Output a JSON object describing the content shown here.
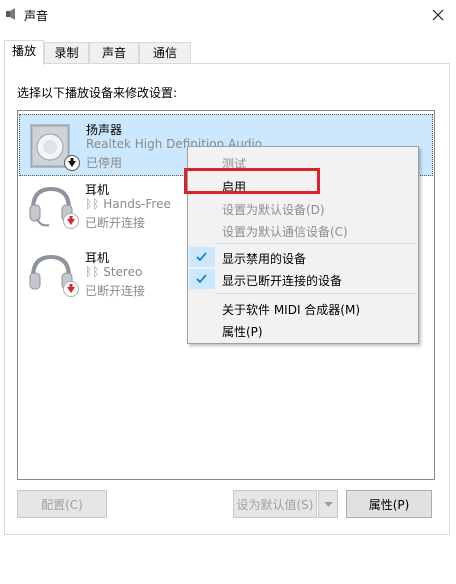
{
  "window": {
    "title": "声音"
  },
  "tabs": [
    {
      "label": "播放",
      "active": true
    },
    {
      "label": "录制",
      "active": false
    },
    {
      "label": "声音",
      "active": false
    },
    {
      "label": "通信",
      "active": false
    }
  ],
  "instruction": "选择以下播放设备来修改设置:",
  "devices": [
    {
      "name": "扬声器",
      "subtitle": "Realtek High Definition Audio",
      "status": "已停用",
      "icon": "speaker-icon",
      "badge": "disabled-arrow-icon",
      "selected": true
    },
    {
      "name": "耳机",
      "subtitle": "Hands-Free",
      "status": "已断开连接",
      "icon": "headset-icon",
      "badge": "disconnected-arrow-icon",
      "selected": false
    },
    {
      "name": "耳机",
      "subtitle": "Stereo",
      "status": "已断开连接",
      "icon": "headphones-icon",
      "badge": "disconnected-arrow-icon",
      "selected": false
    }
  ],
  "buttons": {
    "configure": "配置(C)",
    "set_default": "设为默认值(S)",
    "properties": "属性(P)"
  },
  "context_menu": {
    "items": [
      {
        "label": "测试",
        "enabled": false
      },
      {
        "label": "启用",
        "enabled": true
      },
      {
        "label": "设置为默认设备(D)",
        "enabled": false
      },
      {
        "label": "设置为默认通信设备(C)",
        "enabled": false
      },
      {
        "label": "显示禁用的设备",
        "enabled": true,
        "checked": true
      },
      {
        "label": "显示已断开连接的设备",
        "enabled": true,
        "checked": true
      },
      {
        "label": "关于软件 MIDI 合成器(M)",
        "enabled": true
      },
      {
        "label": "属性(P)",
        "enabled": true
      }
    ]
  },
  "colors": {
    "selection": "#cce8ff",
    "highlight": "#d9232d",
    "check": "#0078d7",
    "badge_red": "#d0282e"
  }
}
